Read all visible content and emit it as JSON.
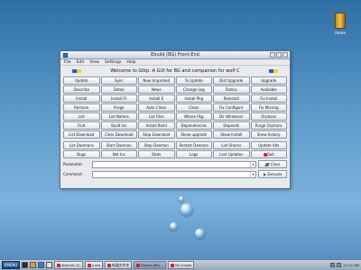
{
  "desktop": {
    "icon_label": "Home"
  },
  "window": {
    "title": "Ebuild (BG) Front-End",
    "menu": [
      "File",
      "Edit",
      "View",
      "Settings",
      "Help"
    ],
    "welcome": "Welcome to Gtkp: A GUI for BG and companion for wolf C",
    "buttons": [
      "Update",
      "Sync",
      "New Unpacked",
      "To Update",
      "Dist Upgrade",
      "Upgrade",
      "Describe",
      "Detail",
      "News",
      "Change Log",
      "Status",
      "Available",
      "Install",
      "Install Fil",
      "Install E",
      "Install Pkg",
      "Reinstall",
      "Fix Install",
      "Remove",
      "Purge",
      "Auto Clean",
      "Clean",
      "Fix Configure",
      "Fix Missing",
      "List",
      "List Names",
      "List Files",
      "Where Pkg",
      "Dir Whatever",
      "Orphans",
      "Find",
      "Build Ins",
      "Install Build",
      "Dependencies",
      "Depends",
      "Purge Orphans",
      "List Download",
      "Clear Download",
      "Stop Download",
      "Show upgrade",
      "Show Install",
      "Show history"
    ],
    "buttons_row2": [
      "List Daemons",
      "Start Daemon",
      "Stop Daemon",
      "Restart Daemon",
      "List Shares",
      "Update Alts"
    ],
    "buttons_row3": [
      "Bugs",
      "Not Ins",
      "Stats",
      "Logs",
      "Last Updates",
      "Quit"
    ],
    "parameter_label": "Parameter:",
    "parameter_value": "",
    "clear_label": "Clear",
    "command_label": "Command:",
    "command_value": "",
    "execute_label": "Execute"
  },
  "taskbar": {
    "start_label": "KMENU",
    "tasks": [
      "dbenkd (3)",
      "x.lite",
      "新建文件夹",
      "Ebuild (BG)...",
      "BG-Install"
    ],
    "clock": "11:22 AM"
  }
}
